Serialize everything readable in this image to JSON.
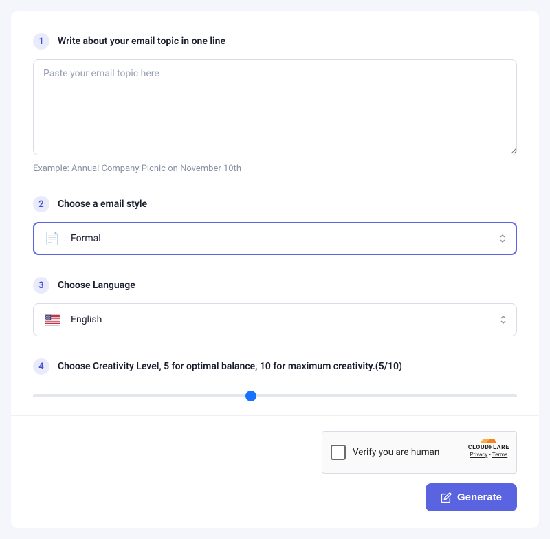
{
  "steps": {
    "topic": {
      "number": "1",
      "label": "Write about your email topic in one line",
      "placeholder": "Paste your email topic here",
      "example_prefix": "Example:  ",
      "example_text": "Annual Company Picnic on November 10th"
    },
    "style": {
      "number": "2",
      "label": "Choose a email style",
      "selected": "Formal",
      "icon": "page-facing-up-icon"
    },
    "language": {
      "number": "3",
      "label": "Choose Language",
      "selected": "English",
      "icon": "us-flag-icon"
    },
    "creativity": {
      "number": "4",
      "label_prefix": "Choose Creativity Level, 5 for optimal balance, 10 for maximum creativity.",
      "current": 5,
      "max": 10,
      "display": "(5/10)"
    }
  },
  "captcha": {
    "text": "Verify you are human",
    "brand": "CLOUDFLARE",
    "privacy": "Privacy",
    "terms": "Terms"
  },
  "actions": {
    "generate": "Generate"
  }
}
